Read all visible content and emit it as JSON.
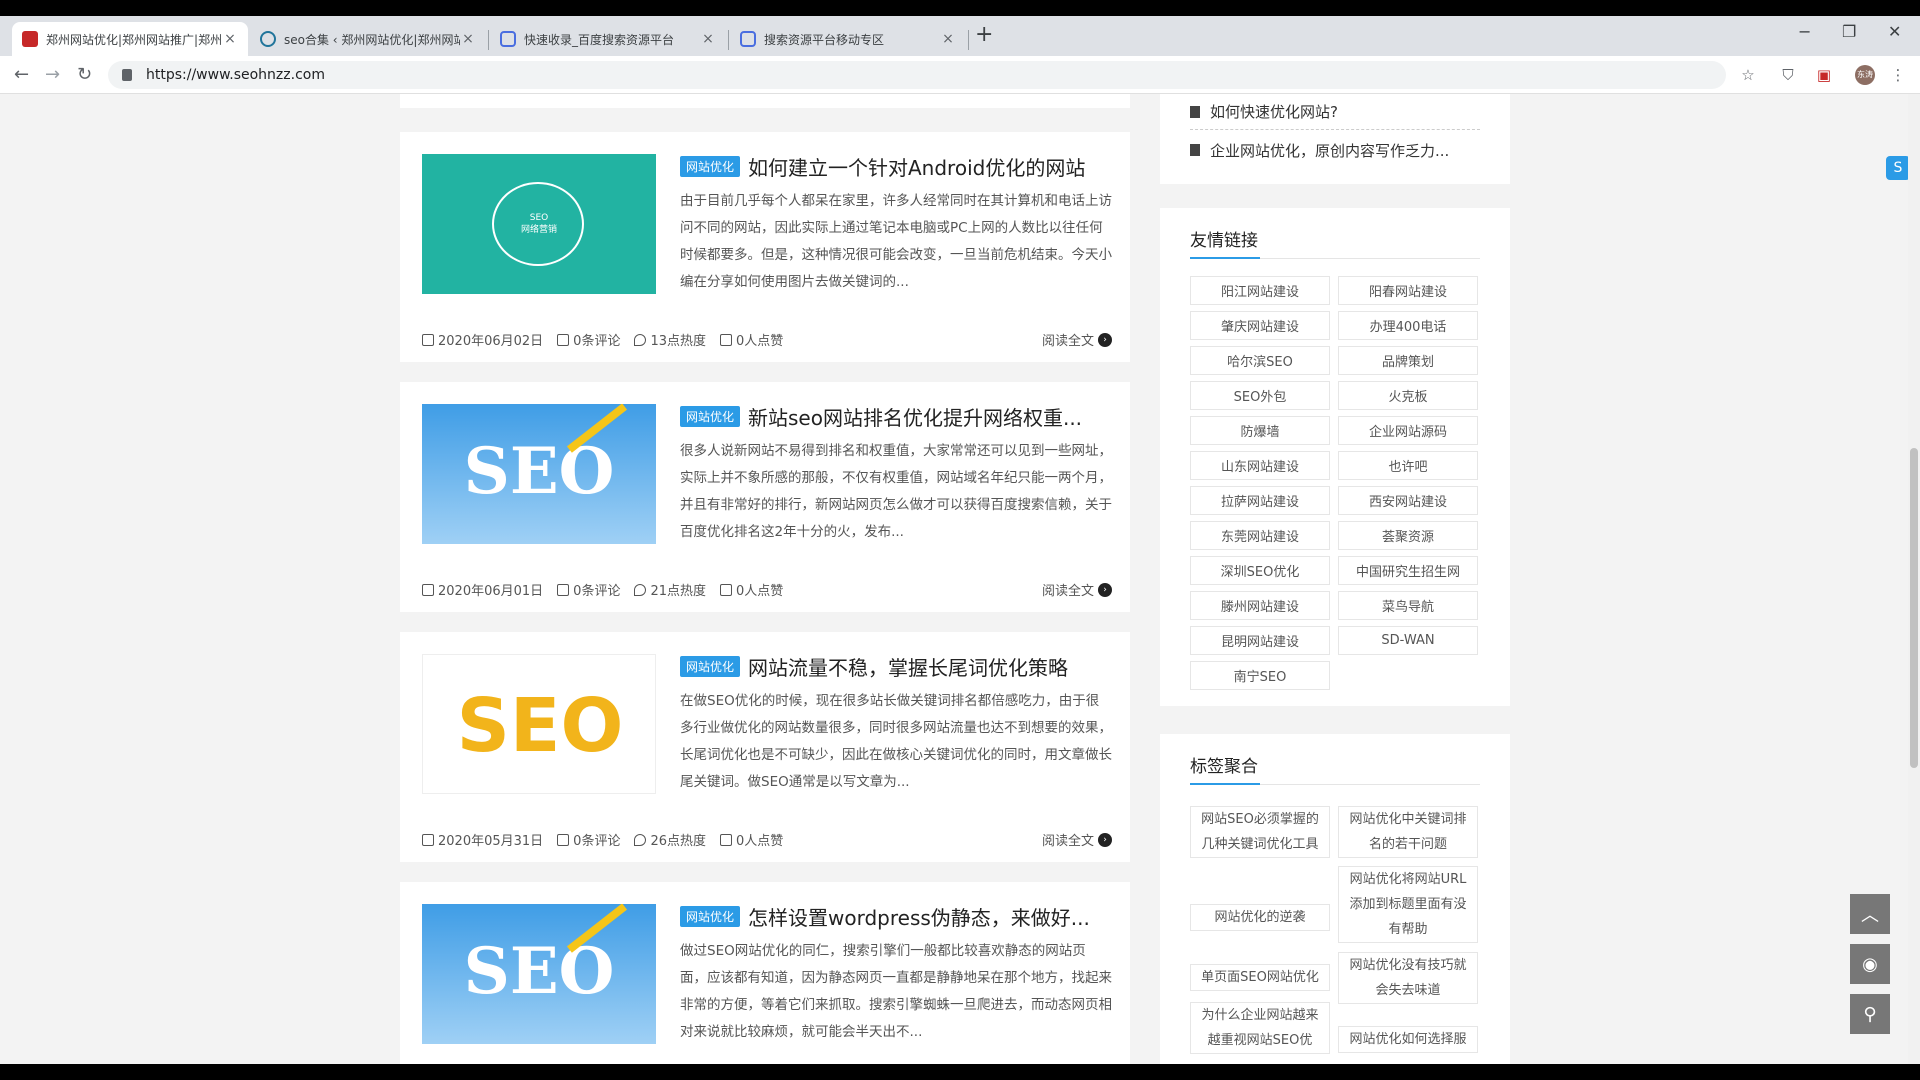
{
  "browser": {
    "tabs": [
      {
        "title": "郑州网站优化|郑州网站推广|郑州",
        "active": true
      },
      {
        "title": "seo合集 ‹ 郑州网站优化|郑州网站",
        "active": false
      },
      {
        "title": "快速收录_百度搜索资源平台",
        "active": false
      },
      {
        "title": "搜索资源平台移动专区",
        "active": false
      }
    ],
    "close_glyph": "×",
    "newtab_glyph": "+",
    "url": "https://www.seohnzz.com",
    "avatar_label": "东涛",
    "window_controls": {
      "minimize": "−",
      "restore": "❐",
      "close": "✕"
    },
    "nav": {
      "back": "←",
      "forward": "→",
      "reload": "↻"
    }
  },
  "sidebar_top": {
    "items": [
      "如何快速优化网站?",
      "企业网站优化，原创内容写作乏力..."
    ]
  },
  "articles": [
    {
      "category": "网站优化",
      "title": "如何建立一个针对Android优化的网站",
      "excerpt": "由于目前几乎每个人都呆在家里，许多人经常同时在其计算机和电话上访问不同的网站，因此实际上通过笔记本电脑或PC上网的人数比以往任何时候都要多。但是，这种情况很可能会改变，一旦当前危机结束。今天小编在分享如何使用图片去做关键词的...",
      "thumb_text": "SEO\n网络营销",
      "date": "2020年06月02日",
      "comments": "0条评论",
      "heat": "13点热度",
      "likes": "0人点赞",
      "readmore": "阅读全文"
    },
    {
      "category": "网站优化",
      "title": "新站seo网站排名优化提升网络权重...",
      "excerpt": "很多人说新网站不易得到排名和权重值，大家常常还可以见到一些网址，实际上并不象所感的那般，不仅有权重值，网站域名年纪只能一两个月，并且有非常好的排行，新网站网页怎么做才可以获得百度搜索信赖，关于百度优化排名这2年十分的火，发布...",
      "thumb_text": "SEO",
      "date": "2020年06月01日",
      "comments": "0条评论",
      "heat": "21点热度",
      "likes": "0人点赞",
      "readmore": "阅读全文"
    },
    {
      "category": "网站优化",
      "title": "网站流量不稳，掌握长尾词优化策略",
      "excerpt": "在做SEO优化的时候，现在很多站长做关键词排名都倍感吃力，由于很多行业做优化的网站数量很多，同时很多网站流量也达不到想要的效果，长尾词优化也是不可缺少，因此在做核心关键词优化的同时，用文章做长尾关键词。做SEO通常是以写文章为...",
      "thumb_text": "SEO",
      "date": "2020年05月31日",
      "comments": "0条评论",
      "heat": "26点热度",
      "likes": "0人点赞",
      "readmore": "阅读全文"
    },
    {
      "category": "网站优化",
      "title": "怎样设置wordpress伪静态，来做好...",
      "excerpt": "做过SEO网站优化的同仁，搜索引擎们一般都比较喜欢静态的网站页面，应该都有知道，因为静态网页一直都是静静地呆在那个地方，找起来非常的方便，等着它们来抓取。搜索引擎蜘蛛一旦爬进去，而动态网页相对来说就比较麻烦，就可能会半天出不...",
      "thumb_text": "SEO",
      "readmore": "阅读全文"
    }
  ],
  "friend_links": {
    "title": "友情链接",
    "items": [
      "阳江网站建设",
      "阳春网站建设",
      "肇庆网站建设",
      "办理400电话",
      "哈尔滨SEO",
      "品牌策划",
      "SEO外包",
      "火克板",
      "防爆墙",
      "企业网站源码",
      "山东网站建设",
      "也许吧",
      "拉萨网站建设",
      "西安网站建设",
      "东莞网站建设",
      "荟聚资源",
      "深圳SEO优化",
      "中国研究生招生网",
      "滕州网站建设",
      "菜鸟导航",
      "昆明网站建设",
      "SD-WAN",
      "南宁SEO"
    ]
  },
  "tags": {
    "title": "标签聚合",
    "items": [
      "网站SEO必须掌握的几种关键词优化工具",
      "网站优化中关键词排名的若干问题",
      "网站优化将网站URL添加到标题里面有没有帮助",
      "网站优化的逆袭",
      "网站优化没有技巧就会失去味道",
      "单页面SEO网站优化",
      "为什么企业网站越来越重视网站SEO优",
      "网站优化如何选择服"
    ]
  },
  "floating": {
    "top": "︿",
    "wechat": "◉",
    "search": "⚲"
  },
  "icons": {
    "plugin": "S"
  },
  "colors": {
    "accent": "#2b9be6",
    "teal": "#22b3a2",
    "seo_yellow": "#f2b41b",
    "sky": "#4ea8e8"
  }
}
